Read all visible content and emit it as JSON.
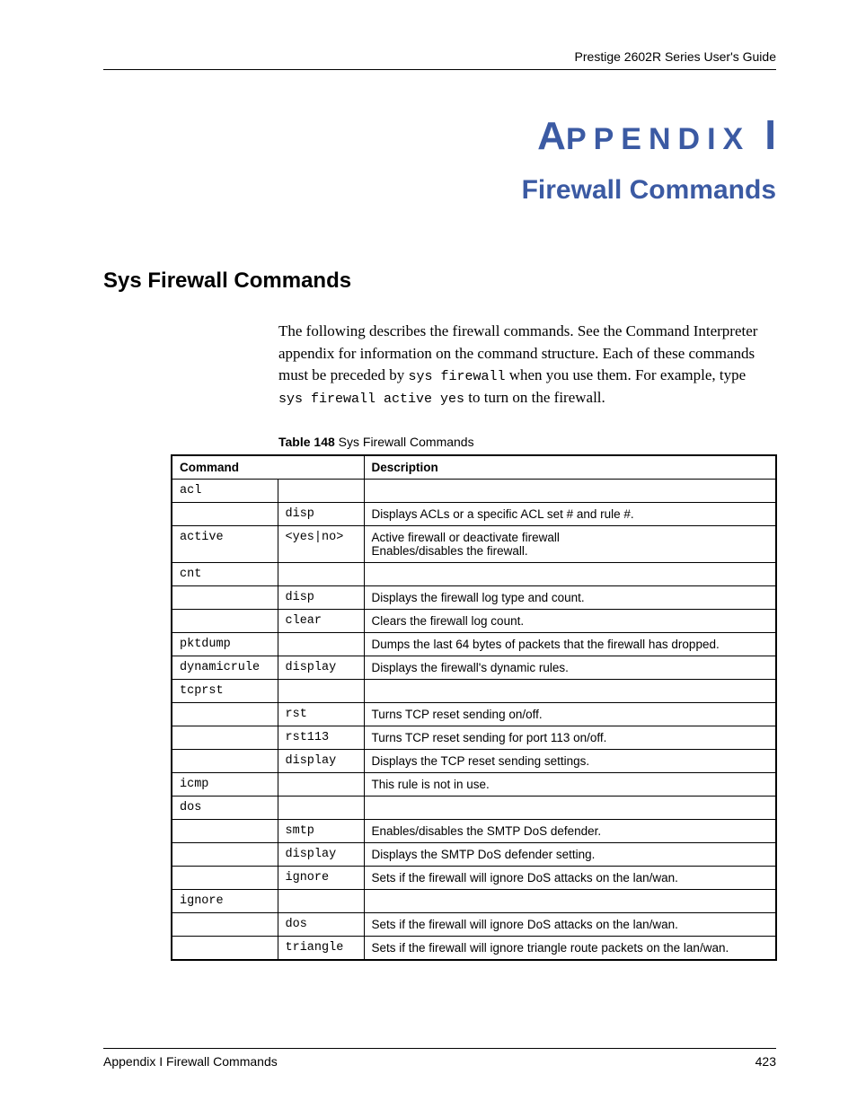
{
  "header": {
    "guide_title": "Prestige 2602R Series User's Guide"
  },
  "appendix": {
    "prefix_big_a": "A",
    "prefix_rest": "PPENDIX",
    "letter": "I",
    "subtitle": "Firewall Commands"
  },
  "section_heading": "Sys Firewall Commands",
  "paragraph": {
    "part1": "The following describes the firewall commands. See the Command Interpreter appendix for information on the command structure. Each of these commands must be preceded by ",
    "code1": "sys firewall",
    "part2": " when you use them. For example, type ",
    "code2": "sys firewall active yes",
    "part3": " to turn on the firewall."
  },
  "table": {
    "caption_bold": "Table 148",
    "caption_rest": "   Sys Firewall Commands",
    "head_command": "Command",
    "head_description": "Description",
    "rows": [
      {
        "c1": "acl",
        "c2": "",
        "desc": ""
      },
      {
        "c1": "",
        "c2": "disp",
        "desc": "Displays ACLs or a specific ACL set # and rule #."
      },
      {
        "c1": "active",
        "c2": "<yes|no>",
        "desc": "Active firewall or deactivate firewall\nEnables/disables the firewall."
      },
      {
        "c1": "cnt",
        "c2": "",
        "desc": ""
      },
      {
        "c1": "",
        "c2": "disp",
        "desc": "Displays the firewall log type and count."
      },
      {
        "c1": "",
        "c2": "clear",
        "desc": "Clears the firewall log count."
      },
      {
        "c1": "pktdump",
        "c2": "",
        "desc": "Dumps the last 64 bytes of packets that the firewall has dropped."
      },
      {
        "c1": "dynamicrule",
        "c2": "display",
        "desc": "Displays the firewall's dynamic rules."
      },
      {
        "c1": "tcprst",
        "c2": "",
        "desc": ""
      },
      {
        "c1": "",
        "c2": "rst",
        "desc": "Turns TCP reset sending on/off."
      },
      {
        "c1": "",
        "c2": "rst113",
        "desc": "Turns TCP reset sending for port 113 on/off."
      },
      {
        "c1": "",
        "c2": "display",
        "desc": "Displays the TCP reset sending settings."
      },
      {
        "c1": "icmp",
        "c2": "",
        "desc": "This rule is not in use."
      },
      {
        "c1": "dos",
        "c2": "",
        "desc": ""
      },
      {
        "c1": "",
        "c2": "smtp",
        "desc": "Enables/disables the SMTP DoS defender."
      },
      {
        "c1": "",
        "c2": "display",
        "desc": "Displays the SMTP DoS defender setting."
      },
      {
        "c1": "",
        "c2": "ignore",
        "desc": "Sets if the firewall will ignore DoS attacks on the lan/wan."
      },
      {
        "c1": "ignore",
        "c2": "",
        "desc": ""
      },
      {
        "c1": "",
        "c2": "dos",
        "desc": "Sets if the firewall will ignore DoS attacks on the lan/wan."
      },
      {
        "c1": "",
        "c2": "triangle",
        "desc": "Sets if the firewall will ignore triangle route packets on the lan/wan."
      }
    ]
  },
  "footer": {
    "left": "Appendix I Firewall Commands",
    "right": "423"
  }
}
